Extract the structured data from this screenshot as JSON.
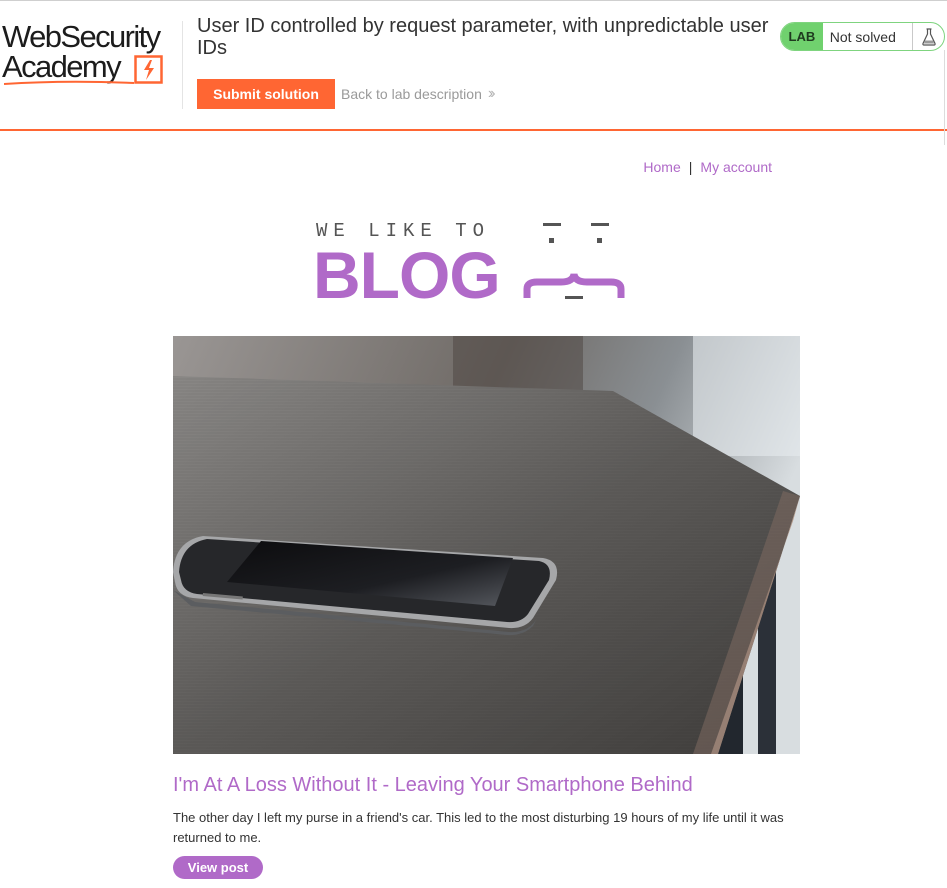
{
  "academy": {
    "logo_line1": "WebSecurity",
    "logo_line2": "Academy",
    "lab_title": "User ID controlled by request parameter, with unpredictable user IDs",
    "submit_label": "Submit solution",
    "back_label": "Back to lab description",
    "lab_tag": "LAB",
    "status": "Not solved",
    "accent_color": "#ff6633",
    "status_color": "#70d16e"
  },
  "nav": {
    "home": "Home",
    "separator": "|",
    "my_account": "My account"
  },
  "banner": {
    "tagline": "WE LIKE TO",
    "word": "BLOG"
  },
  "post": {
    "image_alt": "Smartphone lying on a wooden table",
    "title": "I'm At A Loss Without It - Leaving Your Smartphone Behind",
    "summary": "The other day I left my purse in a friend's car. This led to the most disturbing 19 hours of my life until it was returned to me.",
    "view_label": "View post"
  },
  "brand_color": "#b06ac8"
}
